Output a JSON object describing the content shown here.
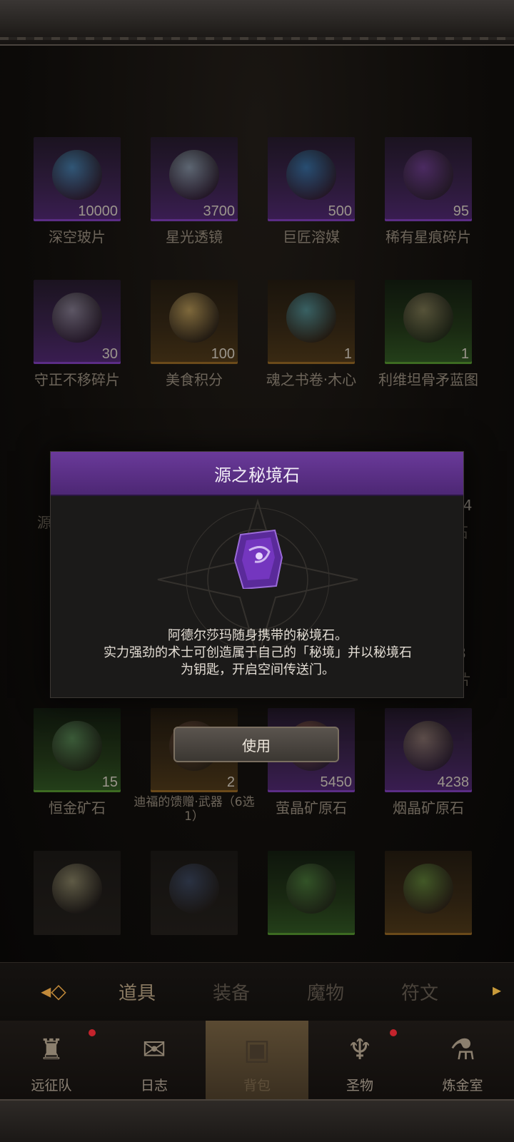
{
  "items": [
    {
      "name": "深空玻片",
      "qty": "10000",
      "rarity": "purple",
      "art": "#3a8ab0"
    },
    {
      "name": "星光透镜",
      "qty": "3700",
      "rarity": "purple",
      "art": "#8aa6a8"
    },
    {
      "name": "巨匠溶媒",
      "qty": "500",
      "rarity": "purple",
      "art": "#2a7aa8"
    },
    {
      "name": "稀有星痕碎片",
      "qty": "95",
      "rarity": "purple",
      "art": "#6a3a8a"
    },
    {
      "name": "守正不移碎片",
      "qty": "30",
      "rarity": "purple",
      "art": "#8a8a90"
    },
    {
      "name": "美食积分",
      "qty": "100",
      "rarity": "gold",
      "art": "#c8a860"
    },
    {
      "name": "魂之书卷·木心",
      "qty": "1",
      "rarity": "gold",
      "art": "#4a9aa8"
    },
    {
      "name": "利维坦骨矛蓝图",
      "qty": "1",
      "rarity": "green",
      "art": "#8a7a5a"
    },
    {
      "name": "恒金矿石",
      "qty": "15",
      "rarity": "green",
      "art": "#5a8a5a"
    },
    {
      "name": "迪福的馈赠·武器（6选1）",
      "qty": "2",
      "rarity": "gold",
      "art": "#6a4a3a"
    },
    {
      "name": "萤晶矿原石",
      "qty": "5450",
      "rarity": "purple",
      "art": "#8a5a3a"
    },
    {
      "name": "烟晶矿原石",
      "qty": "4238",
      "rarity": "purple",
      "art": "#8a7a60"
    },
    {
      "name": "",
      "qty": "",
      "rarity": "dark",
      "art": "#9a9470"
    },
    {
      "name": "",
      "qty": "",
      "rarity": "dark",
      "art": "#3a4a6a"
    },
    {
      "name": "",
      "qty": "",
      "rarity": "green",
      "art": "#4a7a3a"
    },
    {
      "name": "",
      "qty": "",
      "rarity": "gold",
      "art": "#5a8a3a"
    }
  ],
  "partial": {
    "left_name_fragment": "源",
    "right_qty_fragment_1": "54",
    "right_name_fragment_1": "石",
    "right_qty_fragment_2": "8",
    "right_name_fragment_2": "片"
  },
  "modal": {
    "title": "源之秘境石",
    "description_lines": [
      "阿德尔莎玛随身携带的秘境石。",
      "实力强劲的术士可创造属于自己的「秘境」并以秘境石",
      "为钥匙，开启空间传送门。"
    ],
    "use_label": "使用",
    "accent": "#5b2d86"
  },
  "tabs": [
    {
      "label": "道具",
      "active": true
    },
    {
      "label": "装备",
      "active": false
    },
    {
      "label": "魔物",
      "active": false
    },
    {
      "label": "符文",
      "active": false
    }
  ],
  "nav": [
    {
      "label": "远征队",
      "icon": "helmet-icon",
      "badge": true
    },
    {
      "label": "日志",
      "icon": "scroll-icon",
      "badge": false
    },
    {
      "label": "背包",
      "icon": "bag-icon",
      "badge": false,
      "active": true
    },
    {
      "label": "圣物",
      "icon": "chalice-icon",
      "badge": true
    },
    {
      "label": "炼金室",
      "icon": "alchemy-icon",
      "badge": false
    }
  ]
}
